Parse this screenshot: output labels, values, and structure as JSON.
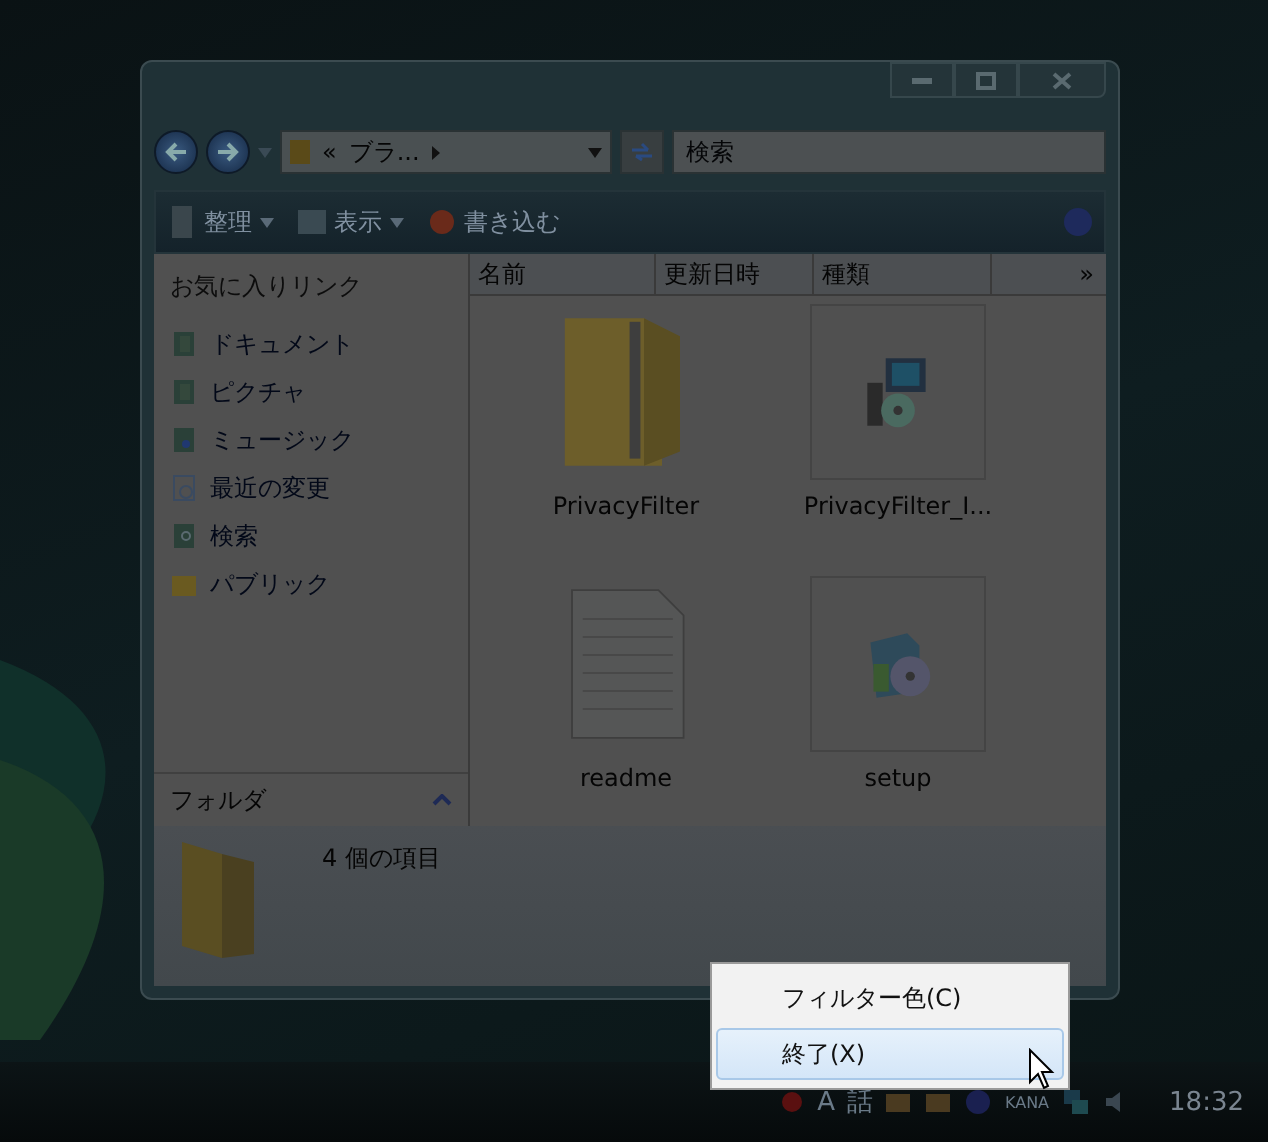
{
  "address_bar": {
    "chevron": "«",
    "path": "ブラ..."
  },
  "search": {
    "placeholder": "検索"
  },
  "toolbar": [
    {
      "label": "整理",
      "kind": "organize",
      "dropdown": true
    },
    {
      "label": "表示",
      "kind": "views",
      "dropdown": true
    },
    {
      "label": "書き込む",
      "kind": "burn",
      "dropdown": false
    }
  ],
  "favorites": {
    "title": "お気に入りリンク",
    "items": [
      {
        "label": "ドキュメント",
        "kind": "doc"
      },
      {
        "label": "ピクチャ",
        "kind": "pic"
      },
      {
        "label": "ミュージック",
        "kind": "music"
      },
      {
        "label": "最近の変更",
        "kind": "recent"
      },
      {
        "label": "検索",
        "kind": "search"
      },
      {
        "label": "パブリック",
        "kind": "folder"
      }
    ]
  },
  "folders_pane": {
    "label": "フォルダ"
  },
  "columns": [
    "名前",
    "更新日時",
    "種類"
  ],
  "more_columns": "»",
  "files": [
    {
      "name": "PrivacyFilter",
      "kind": "zip"
    },
    {
      "name": "PrivacyFilter_I...",
      "kind": "installer"
    },
    {
      "name": "readme",
      "kind": "text"
    },
    {
      "name": "setup",
      "kind": "setup"
    }
  ],
  "details": {
    "count": "4 個の項目"
  },
  "context_menu": [
    {
      "label": "フィルター色(C)",
      "selected": false
    },
    {
      "label": "終了(X)",
      "selected": true
    }
  ],
  "tray": {
    "ime_mode": "A",
    "ime_dict": "話",
    "kana": "KANA",
    "clock": "18:32"
  }
}
